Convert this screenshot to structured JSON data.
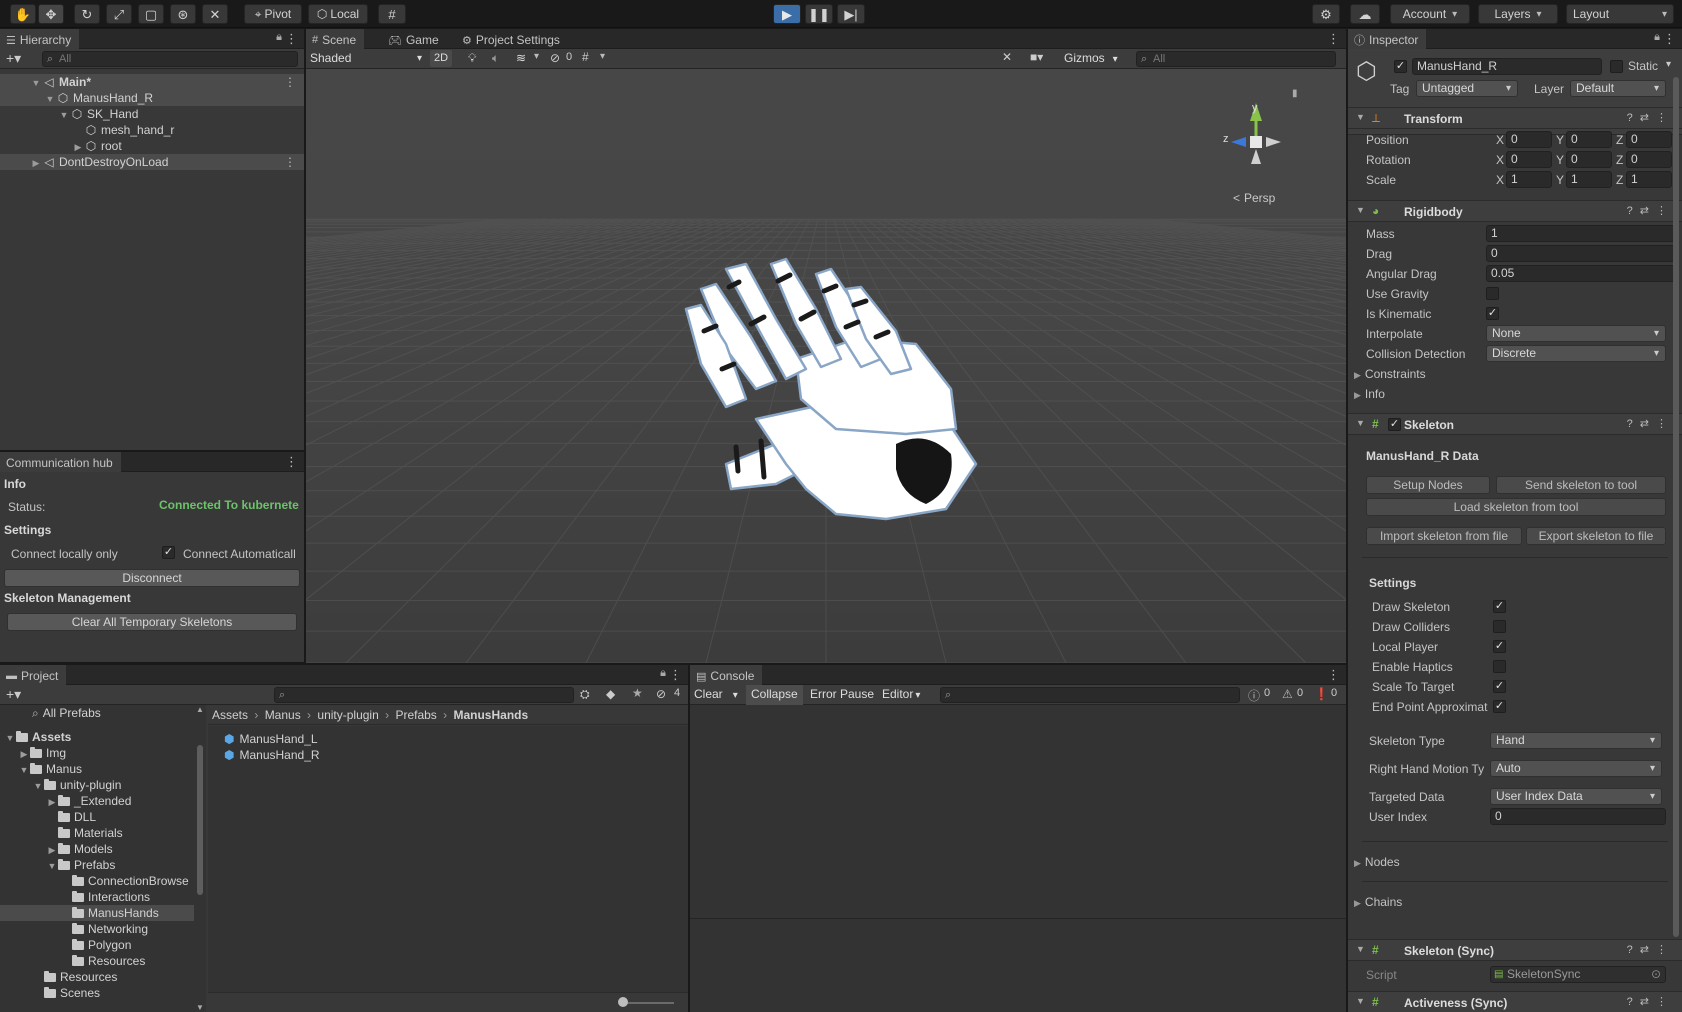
{
  "toolbar": {
    "tools": [
      "hand-tool",
      "move-tool",
      "rotate-tool",
      "scale-tool",
      "rect-tool",
      "transform-tool",
      "custom-tool"
    ],
    "pivot_label": "Pivot",
    "local_label": "Local",
    "account_label": "Account",
    "layers_label": "Layers",
    "layout_label": "Layout"
  },
  "hierarchy": {
    "tab": "Hierarchy",
    "search_placeholder": "All",
    "items": [
      {
        "label": "Main*",
        "indent": 0,
        "caret": "▼",
        "icon": "◁"
      },
      {
        "label": "ManusHand_R",
        "indent": 1,
        "caret": "▼",
        "icon": "⬡"
      },
      {
        "label": "SK_Hand",
        "indent": 2,
        "caret": "▼",
        "icon": "⬡"
      },
      {
        "label": "mesh_hand_r",
        "indent": 3,
        "caret": "",
        "icon": "⬡"
      },
      {
        "label": "root",
        "indent": 3,
        "caret": "▶",
        "icon": "⬡"
      },
      {
        "label": "DontDestroyOnLoad",
        "indent": 0,
        "caret": "▶",
        "icon": "◁"
      }
    ]
  },
  "comm_hub": {
    "tab": "Communication hub",
    "info_header": "Info",
    "status_label": "Status:",
    "status_value": "Connected To kubernete",
    "settings_header": "Settings",
    "connect_locally": "Connect locally only",
    "connect_auto": "Connect Automaticall",
    "disconnect_label": "Disconnect",
    "skeleton_header": "Skeleton Management",
    "clear_label": "Clear All Temporary Skeletons",
    "status_color": "#6cc36a"
  },
  "scene": {
    "tabs": [
      "Scene",
      "Game",
      "Project Settings"
    ],
    "shading": "Shaded",
    "mode_2d": "2D",
    "hidden_count": "0",
    "gizmos_label": "Gizmos",
    "search_placeholder": "All",
    "persp_label": "Persp",
    "axis_y": "y",
    "axis_z": "z"
  },
  "project": {
    "tab": "Project",
    "all_prefabs": "All Prefabs",
    "hidden_count": "4",
    "breadcrumb": [
      "Assets",
      "Manus",
      "unity-plugin",
      "Prefabs",
      "ManusHands"
    ],
    "tree": [
      {
        "label": "Assets",
        "indent": 0,
        "caret": "▼",
        "bold": true
      },
      {
        "label": "Img",
        "indent": 1,
        "caret": "▶"
      },
      {
        "label": "Manus",
        "indent": 1,
        "caret": "▼"
      },
      {
        "label": "unity-plugin",
        "indent": 2,
        "caret": "▼"
      },
      {
        "label": "_Extended",
        "indent": 3,
        "caret": "▶"
      },
      {
        "label": "DLL",
        "indent": 3,
        "caret": ""
      },
      {
        "label": "Materials",
        "indent": 3,
        "caret": ""
      },
      {
        "label": "Models",
        "indent": 3,
        "caret": "▶"
      },
      {
        "label": "Prefabs",
        "indent": 3,
        "caret": "▼"
      },
      {
        "label": "ConnectionBrowse",
        "indent": 4,
        "caret": ""
      },
      {
        "label": "Interactions",
        "indent": 4,
        "caret": ""
      },
      {
        "label": "ManusHands",
        "indent": 4,
        "caret": "",
        "selected": true
      },
      {
        "label": "Networking",
        "indent": 4,
        "caret": ""
      },
      {
        "label": "Polygon",
        "indent": 4,
        "caret": ""
      },
      {
        "label": "Resources",
        "indent": 4,
        "caret": ""
      },
      {
        "label": "Resources",
        "indent": 2,
        "caret": ""
      },
      {
        "label": "Scenes",
        "indent": 2,
        "caret": ""
      }
    ],
    "assets": [
      "ManusHand_L",
      "ManusHand_R"
    ]
  },
  "console": {
    "tab": "Console",
    "clear_label": "Clear",
    "collapse_label": "Collapse",
    "error_pause_label": "Error Pause",
    "editor_label": "Editor",
    "info_count": "0",
    "warn_count": "0",
    "error_count": "0"
  },
  "inspector": {
    "tab": "Inspector",
    "object_name": "ManusHand_R",
    "static_label": "Static",
    "tag_label": "Tag",
    "tag_value": "Untagged",
    "layer_label": "Layer",
    "layer_value": "Default",
    "transform": {
      "title": "Transform",
      "rows": [
        {
          "label": "Position",
          "x": "0",
          "y": "0",
          "z": "0"
        },
        {
          "label": "Rotation",
          "x": "0",
          "y": "0",
          "z": "0"
        },
        {
          "label": "Scale",
          "x": "1",
          "y": "1",
          "z": "1"
        }
      ]
    },
    "rigidbody": {
      "title": "Rigidbody",
      "mass_label": "Mass",
      "mass": "1",
      "drag_label": "Drag",
      "drag": "0",
      "angular_drag_label": "Angular Drag",
      "angular_drag": "0.05",
      "use_gravity_label": "Use Gravity",
      "is_kinematic_label": "Is Kinematic",
      "interpolate_label": "Interpolate",
      "interpolate": "None",
      "collision_label": "Collision Detection",
      "collision": "Discrete",
      "constraints_label": "Constraints",
      "info_label": "Info"
    },
    "skeleton": {
      "title": "Skeleton",
      "data_title": "ManusHand_R Data",
      "setup_nodes": "Setup Nodes",
      "send_to_tool": "Send skeleton to tool",
      "load_from_tool": "Load skeleton from tool",
      "import_file": "Import skeleton from file",
      "export_file": "Export skeleton to file",
      "settings_header": "Settings",
      "settings": [
        {
          "label": "Draw Skeleton",
          "checked": "✓"
        },
        {
          "label": "Draw Colliders",
          "checked": ""
        },
        {
          "label": "Local Player",
          "checked": "✓"
        },
        {
          "label": "Enable Haptics",
          "checked": ""
        },
        {
          "label": "Scale To Target",
          "checked": "✓"
        },
        {
          "label": "End Point Approximat",
          "checked": "✓"
        }
      ],
      "skeleton_type_label": "Skeleton Type",
      "skeleton_type": "Hand",
      "motion_label": "Right Hand Motion Ty",
      "motion": "Auto",
      "targeted_label": "Targeted Data",
      "targeted": "User Index Data",
      "user_index_label": "User Index",
      "user_index": "0",
      "nodes_label": "Nodes",
      "chains_label": "Chains"
    },
    "skeleton_sync": {
      "title": "Skeleton (Sync)",
      "script_label": "Script",
      "script_value": "SkeletonSync"
    },
    "activeness_sync": {
      "title": "Activeness (Sync)"
    }
  }
}
